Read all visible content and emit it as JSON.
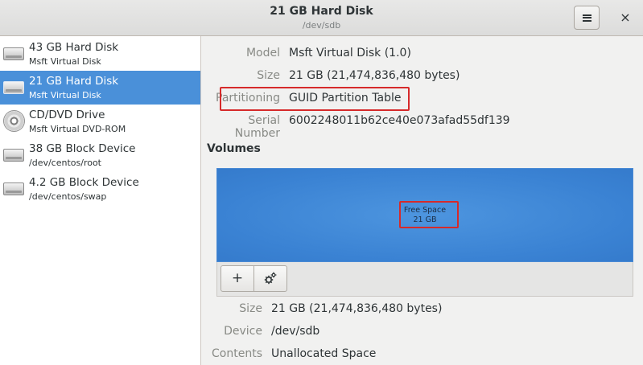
{
  "header": {
    "title": "21 GB Hard Disk",
    "subtitle": "/dev/sdb",
    "menu_icon": "hamburger-menu-icon",
    "close_label": "×"
  },
  "sidebar": {
    "items": [
      {
        "name": "43 GB Hard Disk",
        "sub": "Msft Virtual Disk",
        "icon": "hard-disk-icon",
        "selected": false
      },
      {
        "name": "21 GB Hard Disk",
        "sub": "Msft Virtual Disk",
        "icon": "hard-disk-icon",
        "selected": true
      },
      {
        "name": "CD/DVD Drive",
        "sub": "Msft Virtual DVD-ROM",
        "icon": "optical-disc-icon",
        "selected": false
      },
      {
        "name": "38 GB Block Device",
        "sub": "/dev/centos/root",
        "icon": "block-device-icon",
        "selected": false
      },
      {
        "name": "4.2 GB Block Device",
        "sub": "/dev/centos/swap",
        "icon": "block-device-icon",
        "selected": false
      }
    ]
  },
  "disk": {
    "model_label": "Model",
    "model_value": "Msft Virtual Disk (1.0)",
    "size_label": "Size",
    "size_value": "21 GB (21,474,836,480 bytes)",
    "partitioning_label": "Partitioning",
    "partitioning_value": "GUID Partition Table",
    "serial_label": "Serial Number",
    "serial_value": "6002248011b62ce40e073afad55df139"
  },
  "volumes": {
    "title": "Volumes",
    "segment_name": "Free Space",
    "segment_size": "21 GB",
    "add_label": "+",
    "settings_icon": "gears-icon"
  },
  "volume_details": {
    "size_label": "Size",
    "size_value": "21 GB (21,474,836,480 bytes)",
    "device_label": "Device",
    "device_value": "/dev/sdb",
    "contents_label": "Contents",
    "contents_value": "Unallocated Space"
  },
  "colors": {
    "selection": "#4a90d9",
    "volume_blue": "#3a82d3",
    "highlight_red": "#d62a2a"
  }
}
